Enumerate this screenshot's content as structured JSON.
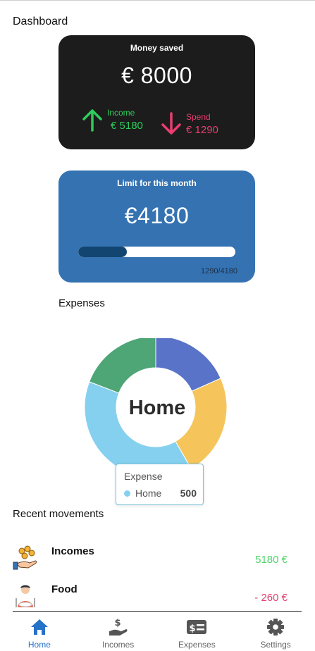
{
  "page": {
    "title": "Dashboard"
  },
  "savings_card": {
    "title": "Money saved",
    "amount": "€ 8000",
    "income": {
      "label": "Income",
      "value": "€ 5180",
      "icon": "arrow-up-icon",
      "color": "#2ecc5c"
    },
    "spend": {
      "label": "Spend",
      "value": "€ 1290",
      "icon": "arrow-down-icon",
      "color": "#ea3d70"
    }
  },
  "limit_card": {
    "title": "Limit for this month",
    "amount": "€4180",
    "progress_fraction": 0.3086,
    "progress_text": "1290/4180"
  },
  "expenses": {
    "label": "Expenses",
    "center_label": "Home",
    "chart_data": {
      "type": "pie",
      "slices": [
        {
          "color": "#5873c8"
        },
        {
          "color": "#f5c55c"
        },
        {
          "name": "Home",
          "value": 500,
          "color": "#86d0ef"
        },
        {
          "color": "#4ea575"
        }
      ]
    },
    "tooltip": {
      "title": "Expense",
      "name": "Home",
      "value": "500"
    }
  },
  "recent": {
    "label": "Recent movements",
    "items": [
      {
        "name": "Incomes",
        "amount": "5180 €",
        "icon": "money-hand-icon"
      },
      {
        "name": "Food",
        "amount": "- 260 €",
        "icon": "person-eating-icon"
      }
    ]
  },
  "nav": {
    "items": [
      {
        "label": "Home",
        "icon": "home-icon",
        "active": true
      },
      {
        "label": "Incomes",
        "icon": "dollar-hand-icon",
        "active": false
      },
      {
        "label": "Expenses",
        "icon": "bill-icon",
        "active": false
      },
      {
        "label": "Settings",
        "icon": "gear-icon",
        "active": false
      }
    ]
  },
  "colors": {
    "accent": "#2572c9",
    "dark_card": "#1c1c1c",
    "limit_card": "#3472b2"
  }
}
